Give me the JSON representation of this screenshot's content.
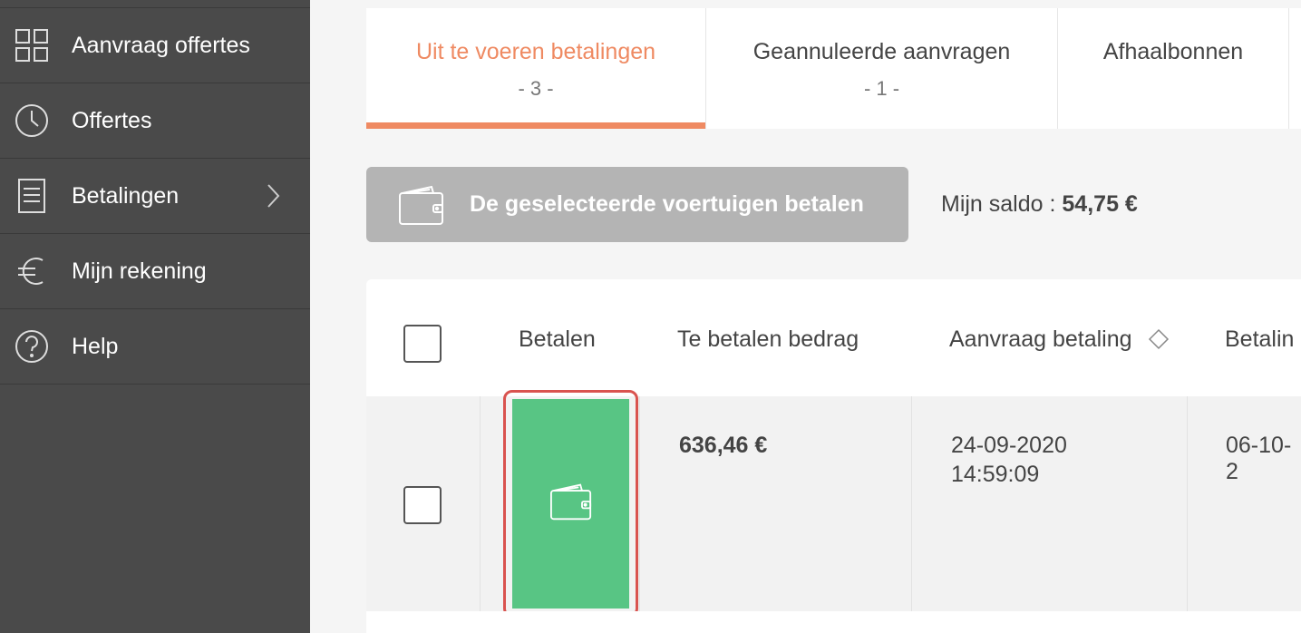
{
  "sidebar": {
    "items": [
      {
        "label": "Aanvraag offertes",
        "icon": "grid-icon"
      },
      {
        "label": "Offertes",
        "icon": "clock-icon"
      },
      {
        "label": "Betalingen",
        "icon": "document-icon"
      },
      {
        "label": "Mijn rekening",
        "icon": "euro-icon"
      },
      {
        "label": "Help",
        "icon": "help-icon"
      }
    ]
  },
  "tabs": [
    {
      "label": "Uit te voeren betalingen",
      "count": "- 3 -",
      "active": true
    },
    {
      "label": "Geannuleerde aanvragen",
      "count": "- 1 -"
    },
    {
      "label": "Afhaalbonnen",
      "count": ""
    }
  ],
  "toolbar": {
    "pay_selected_label": "De geselecteerde voertuigen betalen",
    "saldo_label": "Mijn saldo :",
    "saldo_value": "54,75 €"
  },
  "table": {
    "headers": [
      "Betalen",
      "Te betalen bedrag",
      "Aanvraag betaling",
      "Betalin"
    ],
    "rows": [
      {
        "amount": "636,46 €",
        "request_date": "24-09-2020",
        "request_time": "14:59:09",
        "payment_date": "06-10-2"
      }
    ]
  },
  "colors": {
    "sidebar_bg": "#4a4a4a",
    "accent": "#ef8a62",
    "pay_green": "#58c584",
    "highlight_red": "#d9534f"
  }
}
